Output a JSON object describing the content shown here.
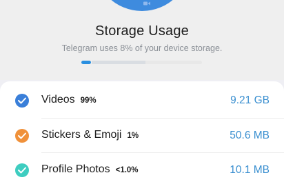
{
  "header": {
    "title": "Storage Usage",
    "subtitle": "Telegram uses 8% of your device storage.",
    "usage_fraction": 0.08
  },
  "colors": {
    "accent_blue": "#3e8bde",
    "size_text": "#3a8fd0",
    "videos": "#3a7fd9",
    "stickers": "#f0913a",
    "profile": "#3ecdc0"
  },
  "items": [
    {
      "label": "Videos",
      "percent": "99%",
      "size": "9.21 GB",
      "checked": true,
      "icon": "check-icon"
    },
    {
      "label": "Stickers & Emoji",
      "percent": "1%",
      "size": "50.6 MB",
      "checked": true,
      "icon": "check-icon"
    },
    {
      "label": "Profile Photos",
      "percent": "<1.0%",
      "size": "10.1 MB",
      "checked": true,
      "icon": "check-icon"
    }
  ]
}
